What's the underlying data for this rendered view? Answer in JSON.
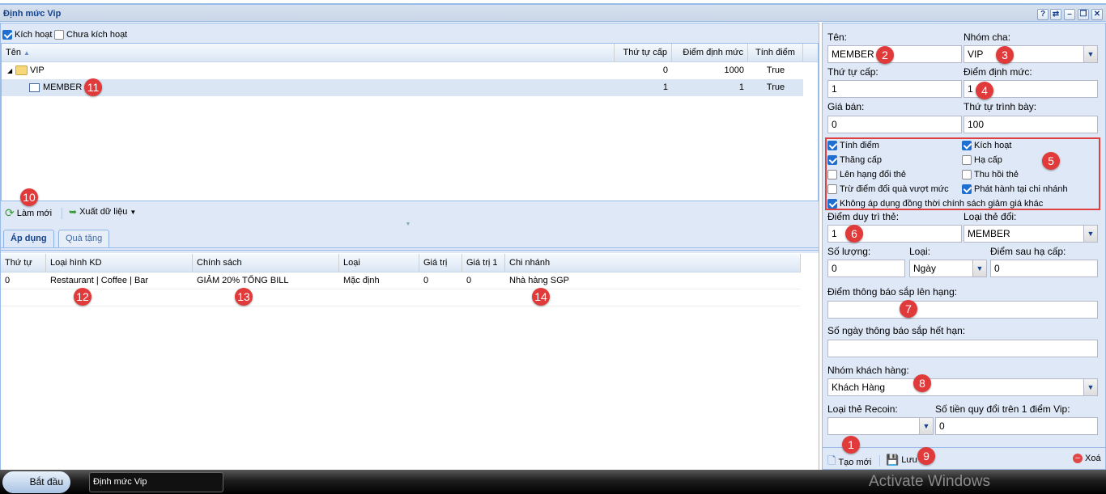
{
  "window": {
    "title": "Định mức Vip",
    "tools": [
      "?",
      "⇄",
      "–",
      "❐",
      "✕"
    ]
  },
  "filters": {
    "active_label": "Kích hoạt",
    "active_checked": true,
    "inactive_label": "Chưa kích hoạt",
    "inactive_checked": false
  },
  "tree_grid": {
    "columns": [
      "Tên",
      "Thứ tự cấp",
      "Điểm định mức",
      "Tính điểm"
    ],
    "rows": [
      {
        "name": "VIP",
        "level": "0",
        "points": "1000",
        "calc": "True",
        "icon": "folder-icon"
      },
      {
        "name": "MEMBER",
        "level": "1",
        "points": "1",
        "calc": "True",
        "icon": "record-icon"
      }
    ]
  },
  "toolbar": {
    "refresh": "Làm mới",
    "export": "Xuất dữ liệu"
  },
  "tabs": [
    "Áp dụng",
    "Quà tặng"
  ],
  "policy_grid": {
    "columns": [
      "Thứ tự",
      "Loại hình KD",
      "Chính sách",
      "Loại",
      "Giá trị",
      "Giá trị 1",
      "Chi nhánh"
    ],
    "rows": [
      [
        "0",
        "Restaurant | Coffee | Bar",
        "GIẢM 20% TỔNG BILL",
        "Mặc định",
        "0",
        "0",
        "Nhà hàng SGP"
      ]
    ]
  },
  "form": {
    "name_label": "Tên:",
    "name": "MEMBER",
    "parent_label": "Nhóm cha:",
    "parent": "VIP",
    "level_label": "Thứ tự cấp:",
    "level": "1",
    "quota_label": "Điểm định mức:",
    "quota": "1",
    "price_label": "Giá bán:",
    "price": "0",
    "order_label": "Thứ tự trình bày:",
    "order": "100",
    "checks": [
      {
        "label": "Tính điểm",
        "checked": true
      },
      {
        "label": "Kích hoạt",
        "checked": true
      },
      {
        "label": "Thăng cấp",
        "checked": true
      },
      {
        "label": "Hạ cấp",
        "checked": false
      },
      {
        "label": "Lên hạng đổi thẻ",
        "checked": false
      },
      {
        "label": "Thu hồi thẻ",
        "checked": false
      },
      {
        "label": "Trừ điểm đổi quà vượt mức",
        "checked": false
      },
      {
        "label": "Phát hành tại chi nhánh",
        "checked": true
      },
      {
        "label": "Không áp dụng đồng thời chính sách giảm giá khác",
        "checked": true
      }
    ],
    "keep_label": "Điểm duy trì thẻ:",
    "keep": "1",
    "card_type_label": "Loại thẻ đổi:",
    "card_type": "MEMBER",
    "qty_label": "Số lượng:",
    "qty": "0",
    "unit_label": "Loại:",
    "unit": "Ngày",
    "after_label": "Điểm sau hạ cấp:",
    "after": "0",
    "notify_up_label": "Điểm thông báo sắp lên hạng:",
    "notify_up": "",
    "notify_exp_label": "Số ngày thông báo sắp hết hạn:",
    "notify_exp": "",
    "group_label": "Nhóm khách hàng:",
    "group": "Khách Hàng",
    "recoin_label": "Loại thẻ Recoin:",
    "recoin": "",
    "rate_label": "Số tiền quy đổi trên 1 điểm Vip:",
    "rate": "0"
  },
  "actions": {
    "new": "Tạo mới",
    "save": "Lưu",
    "delete": "Xoá"
  },
  "taskbar": {
    "start": "Bắt đầu",
    "task": "Định mức Vip",
    "watermark": "Activate Windows"
  },
  "annotations": [
    "1",
    "2",
    "3",
    "4",
    "5",
    "6",
    "7",
    "8",
    "9",
    "10",
    "11",
    "12",
    "13",
    "14"
  ]
}
